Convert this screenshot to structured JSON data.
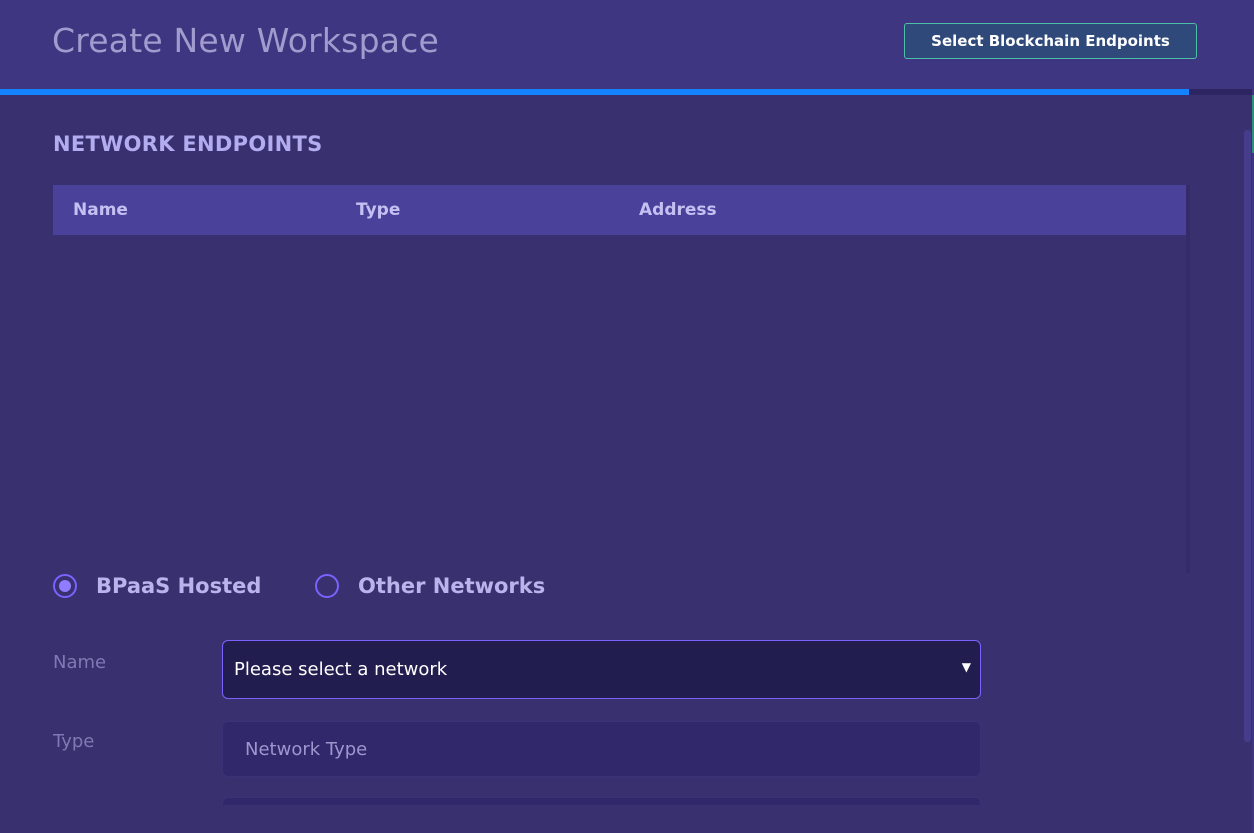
{
  "header": {
    "title": "Create New Workspace",
    "select_endpoints_label": "Select Blockchain Endpoints"
  },
  "progress": {
    "fraction": 0.95
  },
  "section": {
    "title": "NETWORK ENDPOINTS"
  },
  "table": {
    "columns": [
      "Name",
      "Type",
      "Address"
    ],
    "rows": []
  },
  "network_source": {
    "options": [
      {
        "label": "BPaaS Hosted",
        "selected": true
      },
      {
        "label": "Other Networks",
        "selected": false
      }
    ]
  },
  "form": {
    "name_label": "Name",
    "name_select_value": "Please select a network",
    "type_label": "Type",
    "type_placeholder": "Network Type"
  },
  "colors": {
    "background": "#39306f",
    "header": "#3e3680",
    "accent": "#1583ff",
    "radio": "#7b62ff",
    "button_border": "#4dbfa9"
  }
}
